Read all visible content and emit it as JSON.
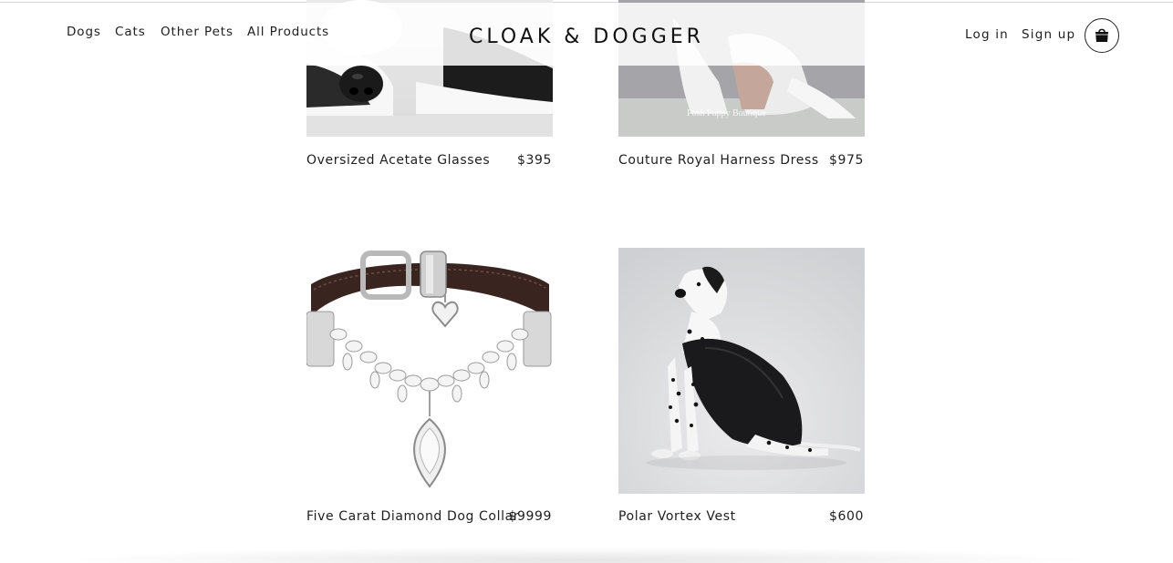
{
  "nav": {
    "links": [
      "Dogs",
      "Cats",
      "Other Pets",
      "All Products"
    ]
  },
  "brand": {
    "logo": "CLOAK & DOGGER"
  },
  "auth": {
    "login": "Log in",
    "signup": "Sign up"
  },
  "products": [
    {
      "title": "Oversized Acetate Glasses",
      "price": "$395"
    },
    {
      "title": "Couture Royal Harness Dress",
      "price": "$975"
    },
    {
      "title": "Five Carat Diamond Dog Collar",
      "price": "$9999"
    },
    {
      "title": "Polar Vortex Vest",
      "price": "$600"
    }
  ],
  "watermark": "Posh Puppy Boutique",
  "colors": {
    "text": "#1e1e1e",
    "background": "#ffffff",
    "header_overlay": "rgba(255,255,255,0.86)"
  },
  "icons": {
    "cart": "shopping-bag-icon"
  }
}
